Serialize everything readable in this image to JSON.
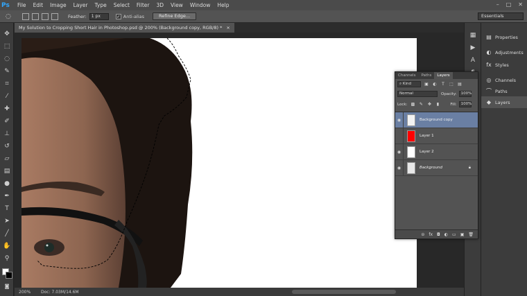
{
  "app": {
    "logo": "Ps",
    "menu": [
      "File",
      "Edit",
      "Image",
      "Layer",
      "Type",
      "Select",
      "Filter",
      "3D",
      "View",
      "Window",
      "Help"
    ],
    "window_controls": [
      "–",
      "□",
      "✕"
    ]
  },
  "options_bar": {
    "feather_label": "Feather:",
    "feather_value": "1 px",
    "antialias_label": "Anti-alias",
    "refine_edge_label": "Refine Edge...",
    "workspace": "Essentials"
  },
  "document": {
    "tab_title": "My Solution to Cropping Short Hair in Photoshop.psd @ 200% (Background copy, RGB/8) *",
    "tab_close": "×"
  },
  "status_bar": {
    "zoom": "200%",
    "doc_size": "Doc: 7.03M/14.6M"
  },
  "dock": {
    "items": [
      {
        "label": "Properties",
        "icon": "properties-icon"
      },
      {
        "label": "Adjustments",
        "icon": "adjustments-icon"
      },
      {
        "label": "Styles",
        "icon": "styles-icon"
      },
      {
        "label": "Channels",
        "icon": "channels-icon"
      },
      {
        "label": "Paths",
        "icon": "paths-icon"
      },
      {
        "label": "Layers",
        "icon": "layers-icon"
      }
    ]
  },
  "layers_panel": {
    "tabs": [
      "Channels",
      "Paths",
      "Layers"
    ],
    "active_tab": "Layers",
    "filter_kind": "Kind",
    "blend_mode": "Normal",
    "opacity_label": "Opacity:",
    "opacity_value": "100%",
    "lock_label": "Lock:",
    "fill_label": "Fill:",
    "fill_value": "100%",
    "layers": [
      {
        "name": "Background copy",
        "thumb_color": "#f2f2f2",
        "selected": true,
        "visible": true
      },
      {
        "name": "Layer 1",
        "thumb_color": "#ff0000",
        "selected": false,
        "visible": false
      },
      {
        "name": "Layer 2",
        "thumb_color": "#ffffff",
        "selected": false,
        "visible": true
      },
      {
        "name": "Background",
        "thumb_color": "#e8e8e8",
        "selected": false,
        "visible": true,
        "locked": true
      }
    ]
  }
}
